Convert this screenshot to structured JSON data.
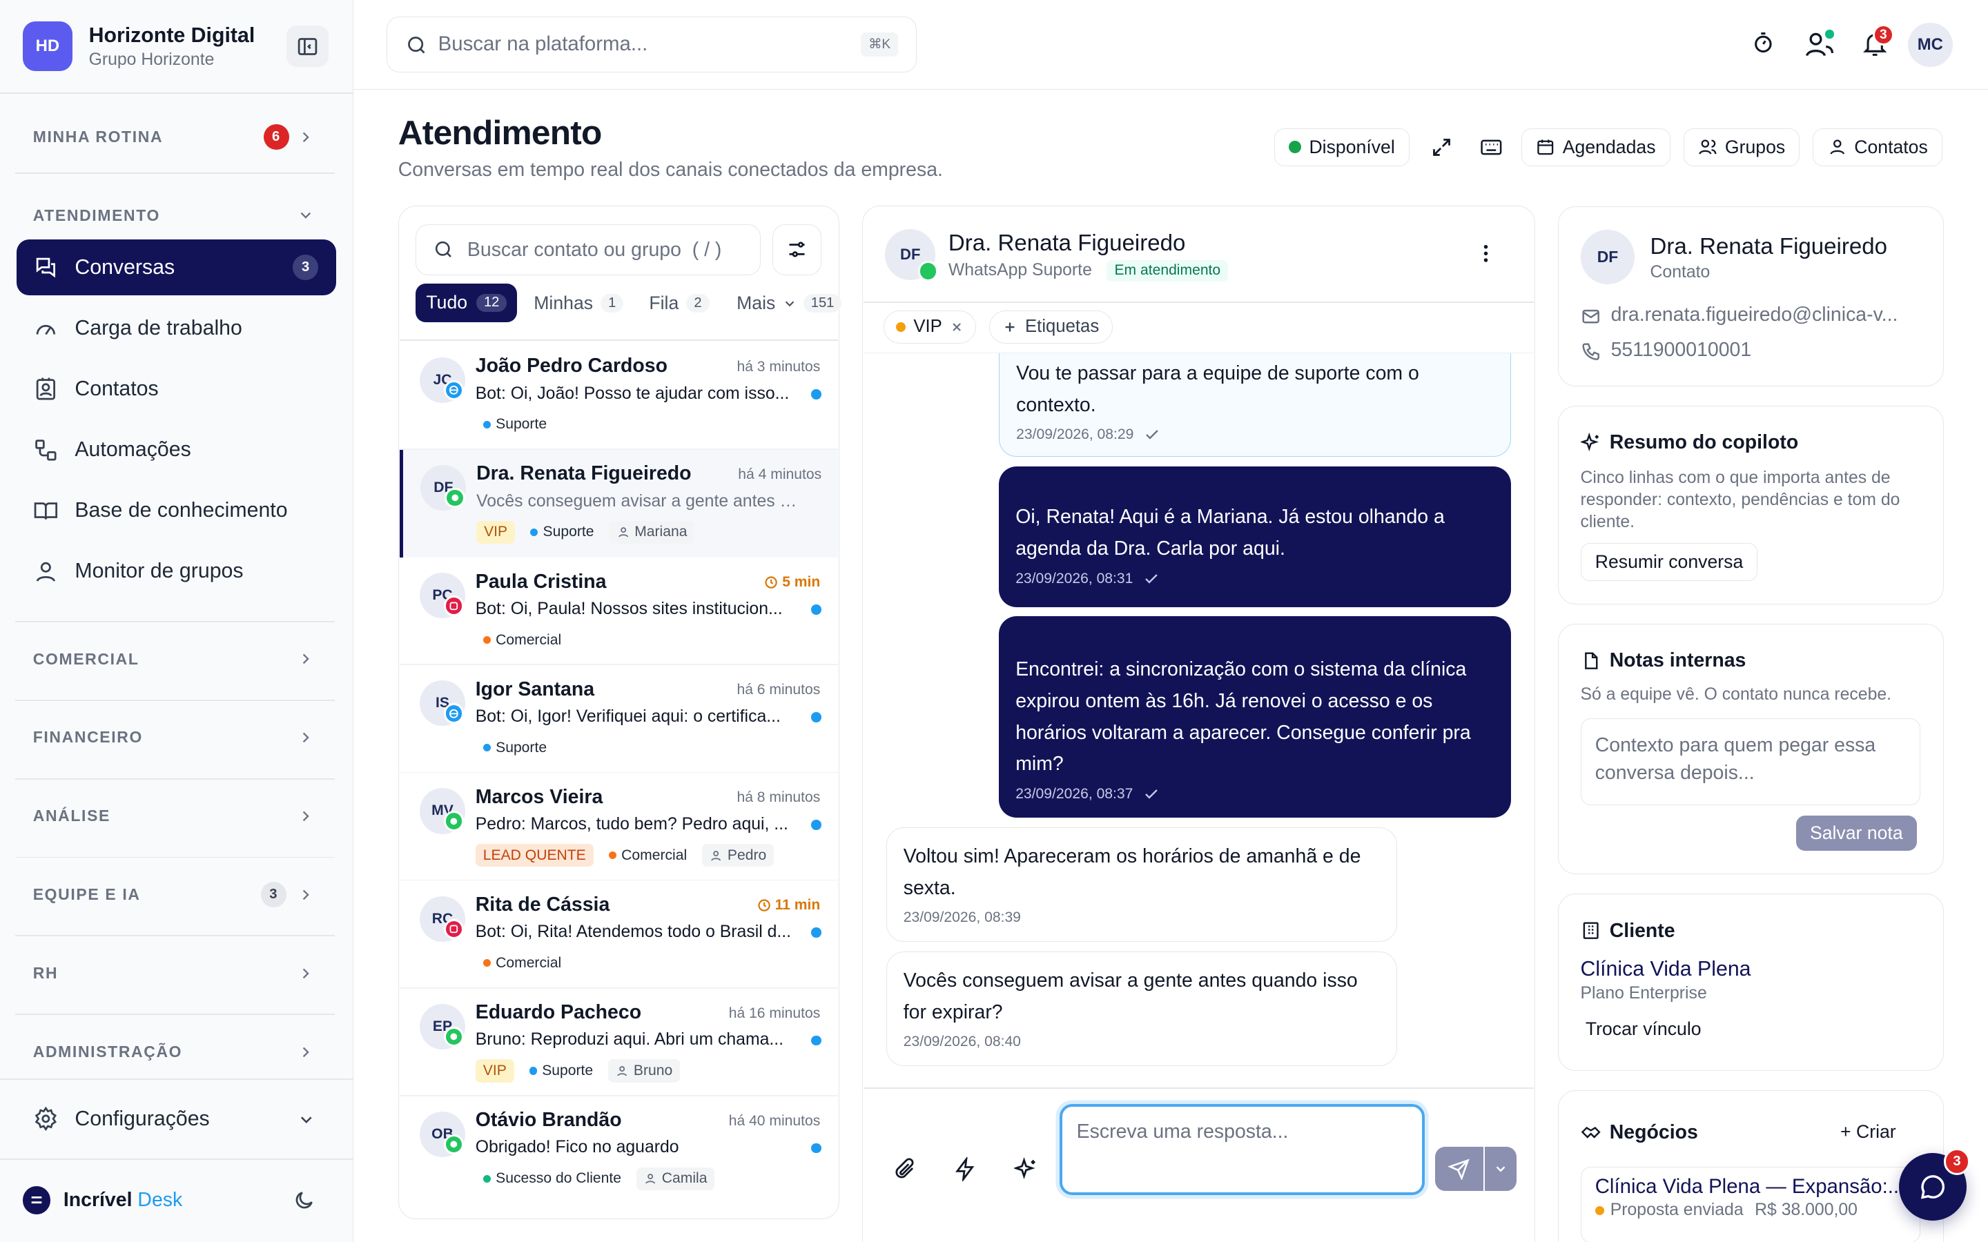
{
  "workspace": {
    "initials": "HD",
    "name": "Horizonte Digital",
    "group": "Grupo Horizonte"
  },
  "sidebar": {
    "minha_rotina": {
      "label": "MINHA ROTINA",
      "badge": "6"
    },
    "atendimento": {
      "label": "ATENDIMENTO"
    },
    "items": [
      {
        "label": "Conversas",
        "badge": "3"
      },
      {
        "label": "Carga de trabalho"
      },
      {
        "label": "Contatos"
      },
      {
        "label": "Automações"
      },
      {
        "label": "Base de conhecimento"
      },
      {
        "label": "Monitor de grupos"
      }
    ],
    "sections": [
      {
        "label": "COMERCIAL"
      },
      {
        "label": "FINANCEIRO"
      },
      {
        "label": "ANÁLISE"
      },
      {
        "label": "EQUIPE E IA",
        "badge": "3"
      },
      {
        "label": "RH"
      },
      {
        "label": "ADMINISTRAÇÃO"
      }
    ],
    "settings": "Configurações",
    "brand": {
      "name": "Incrível",
      "accent": "Desk"
    }
  },
  "topbar": {
    "search_placeholder": "Buscar na plataforma...",
    "shortcut": "⌘K",
    "notif_count": "3",
    "user_initials": "MC"
  },
  "page": {
    "title": "Atendimento",
    "subtitle": "Conversas em tempo real dos canais conectados da empresa.",
    "status": "Disponível",
    "btn_agendadas": "Agendadas",
    "btn_grupos": "Grupos",
    "btn_contatos": "Contatos"
  },
  "list": {
    "search_placeholder": "Buscar contato ou grupo  ( / )",
    "tabs": [
      {
        "label": "Tudo",
        "count": "12"
      },
      {
        "label": "Minhas",
        "count": "1"
      },
      {
        "label": "Fila",
        "count": "2"
      },
      {
        "label": "Mais",
        "count": "151"
      }
    ],
    "items": [
      {
        "initials": "JC",
        "name": "João Pedro Cardoso",
        "time": "há 3 minutos",
        "preview": "Bot: Oi, João! Posso te ajudar com isso...",
        "tags": [
          "Suporte"
        ]
      },
      {
        "initials": "DF",
        "name": "Dra. Renata Figueiredo",
        "time": "há 4 minutos",
        "preview": "Vocês conseguem avisar a gente antes q...",
        "tags": [
          "VIP",
          "Suporte",
          "Mariana"
        ]
      },
      {
        "initials": "PC",
        "name": "Paula Cristina",
        "time": "5 min",
        "preview": "Bot: Oi, Paula! Nossos sites institucion...",
        "tags": [
          "Comercial"
        ]
      },
      {
        "initials": "IS",
        "name": "Igor Santana",
        "time": "há 6 minutos",
        "preview": "Bot: Oi, Igor! Verifiquei aqui: o certifica...",
        "tags": [
          "Suporte"
        ]
      },
      {
        "initials": "MV",
        "name": "Marcos Vieira",
        "time": "há 8 minutos",
        "preview": "Pedro: Marcos, tudo bem? Pedro aqui, ...",
        "tags": [
          "LEAD QUENTE",
          "Comercial",
          "Pedro"
        ]
      },
      {
        "initials": "RC",
        "name": "Rita de Cássia",
        "time": "11 min",
        "preview": "Bot: Oi, Rita! Atendemos todo o Brasil d...",
        "tags": [
          "Comercial"
        ]
      },
      {
        "initials": "EP",
        "name": "Eduardo Pacheco",
        "time": "há 16 minutos",
        "preview": "Bruno: Reproduzi aqui. Abri um chama...",
        "tags": [
          "VIP",
          "Suporte",
          "Bruno"
        ]
      },
      {
        "initials": "OB",
        "name": "Otávio Brandão",
        "time": "há 40 minutos",
        "preview": "Obrigado! Fico no aguardo",
        "tags": [
          "Sucesso do Cliente",
          "Camila"
        ]
      }
    ]
  },
  "chat": {
    "contact_initials": "DF",
    "contact_name": "Dra. Renata Figueiredo",
    "channel": "WhatsApp Suporte",
    "status": "Em atendimento",
    "tag_vip": "VIP",
    "tag_add": "Etiquetas",
    "messages": [
      {
        "text": "Vou te passar para a equipe de suporte com o contexto.",
        "meta": "23/09/2026, 08:29"
      },
      {
        "text": "Oi, Renata! Aqui é a Mariana. Já estou olhando a agenda da Dra. Carla por aqui.",
        "meta": "23/09/2026, 08:31"
      },
      {
        "text": "Encontrei: a sincronização com o sistema da clínica expirou ontem às 16h. Já renovei o acesso e os horários voltaram a aparecer. Consegue conferir pra mim?",
        "meta": "23/09/2026, 08:37"
      },
      {
        "text": "Voltou sim! Apareceram os horários de amanhã e de sexta.",
        "meta": "23/09/2026, 08:39"
      },
      {
        "text": "Vocês conseguem avisar a gente antes quando isso for expirar?",
        "meta": "23/09/2026, 08:40"
      }
    ],
    "reply_placeholder": "Escreva uma resposta..."
  },
  "right": {
    "contact": {
      "initials": "DF",
      "name": "Dra. Renata Figueiredo",
      "role": "Contato",
      "email": "dra.renata.figueiredo@clinica-v...",
      "phone": "5511900010001"
    },
    "copilot": {
      "title": "Resumo do copiloto",
      "desc": "Cinco linhas com o que importa antes de responder: contexto, pendências e tom do cliente.",
      "button": "Resumir conversa"
    },
    "notes": {
      "title": "Notas internas",
      "desc": "Só a equipe vê. O contato nunca recebe.",
      "placeholder": "Contexto para quem pegar essa conversa depois...",
      "button": "Salvar nota"
    },
    "client": {
      "title": "Cliente",
      "name": "Clínica Vida Plena",
      "plan": "Plano Enterprise",
      "button": "Trocar vínculo"
    },
    "deals": {
      "title": "Negócios",
      "create": "+ Criar",
      "deal_name": "Clínica Vida Plena — Expansão:...",
      "deal_status": "Proposta enviada",
      "deal_value": "R$ 38.000,00"
    },
    "fab_badge": "3"
  }
}
